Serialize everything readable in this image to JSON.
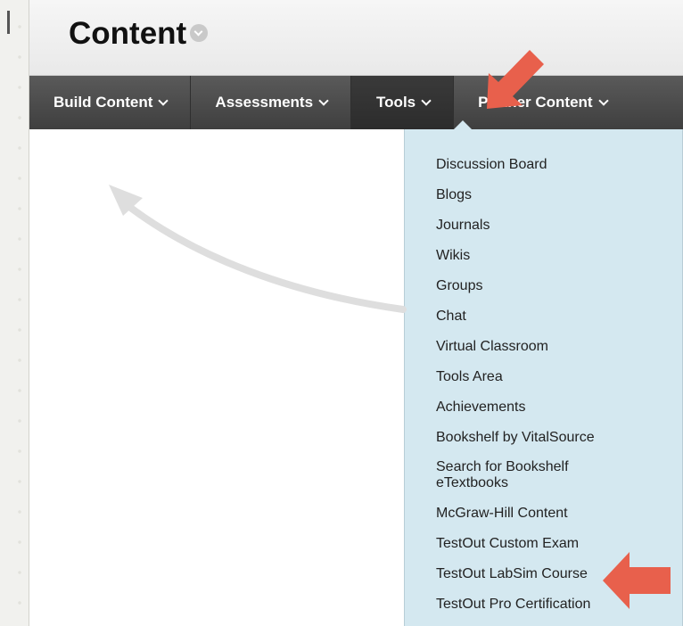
{
  "header": {
    "title": "Content"
  },
  "toolbar": {
    "items": [
      {
        "label": "Build Content"
      },
      {
        "label": "Assessments"
      },
      {
        "label": "Tools"
      },
      {
        "label": "Partner Content"
      }
    ],
    "active_index": 2
  },
  "dropdown": {
    "items": [
      {
        "label": "Discussion Board"
      },
      {
        "label": "Blogs"
      },
      {
        "label": "Journals"
      },
      {
        "label": "Wikis"
      },
      {
        "label": "Groups"
      },
      {
        "label": "Chat"
      },
      {
        "label": "Virtual Classroom"
      },
      {
        "label": "Tools Area"
      },
      {
        "label": "Achievements"
      },
      {
        "label": "Bookshelf by VitalSource"
      },
      {
        "label": "Search for Bookshelf eTextbooks"
      },
      {
        "label": "McGraw-Hill Content"
      },
      {
        "label": "TestOut Custom Exam"
      },
      {
        "label": "TestOut LabSim Course"
      },
      {
        "label": "TestOut Pro Certification"
      }
    ]
  },
  "colors": {
    "toolbar_bg": "#4a4a4a",
    "dropdown_bg": "#d4e8f0",
    "annotation_arrow": "#e8604c",
    "curved_arrow": "#dcdcdc"
  }
}
